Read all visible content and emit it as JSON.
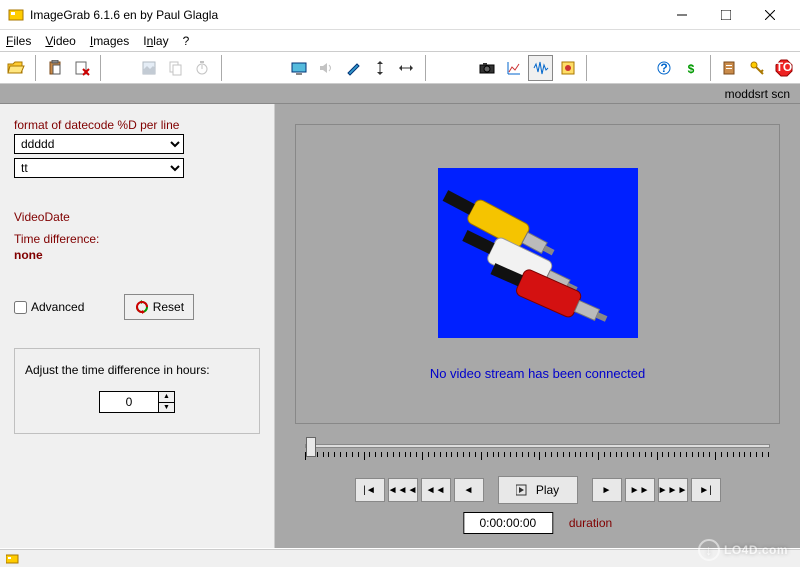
{
  "window": {
    "title": "ImageGrab 6.1.6 en by Paul Glagla"
  },
  "menu": {
    "files": "Files",
    "video": "Video",
    "images": "Images",
    "inlay": "Inlay",
    "help": "?"
  },
  "status_strip": "moddsrt scn",
  "left": {
    "format_label": "format of datecode %D per line",
    "format1_value": "ddddd",
    "format2_value": "tt",
    "videodate_label": "VideoDate",
    "timediff_label": "Time difference:",
    "timediff_value": "none",
    "advanced_label": "Advanced",
    "reset_label": "Reset",
    "adjust_label": "Adjust the time difference in hours:",
    "adjust_value": "0"
  },
  "video": {
    "no_stream": "No video stream has been connected",
    "play_label": "Play",
    "timecode": "0:00:00:00",
    "duration_label": "duration"
  },
  "watermark": "LO4D.com"
}
